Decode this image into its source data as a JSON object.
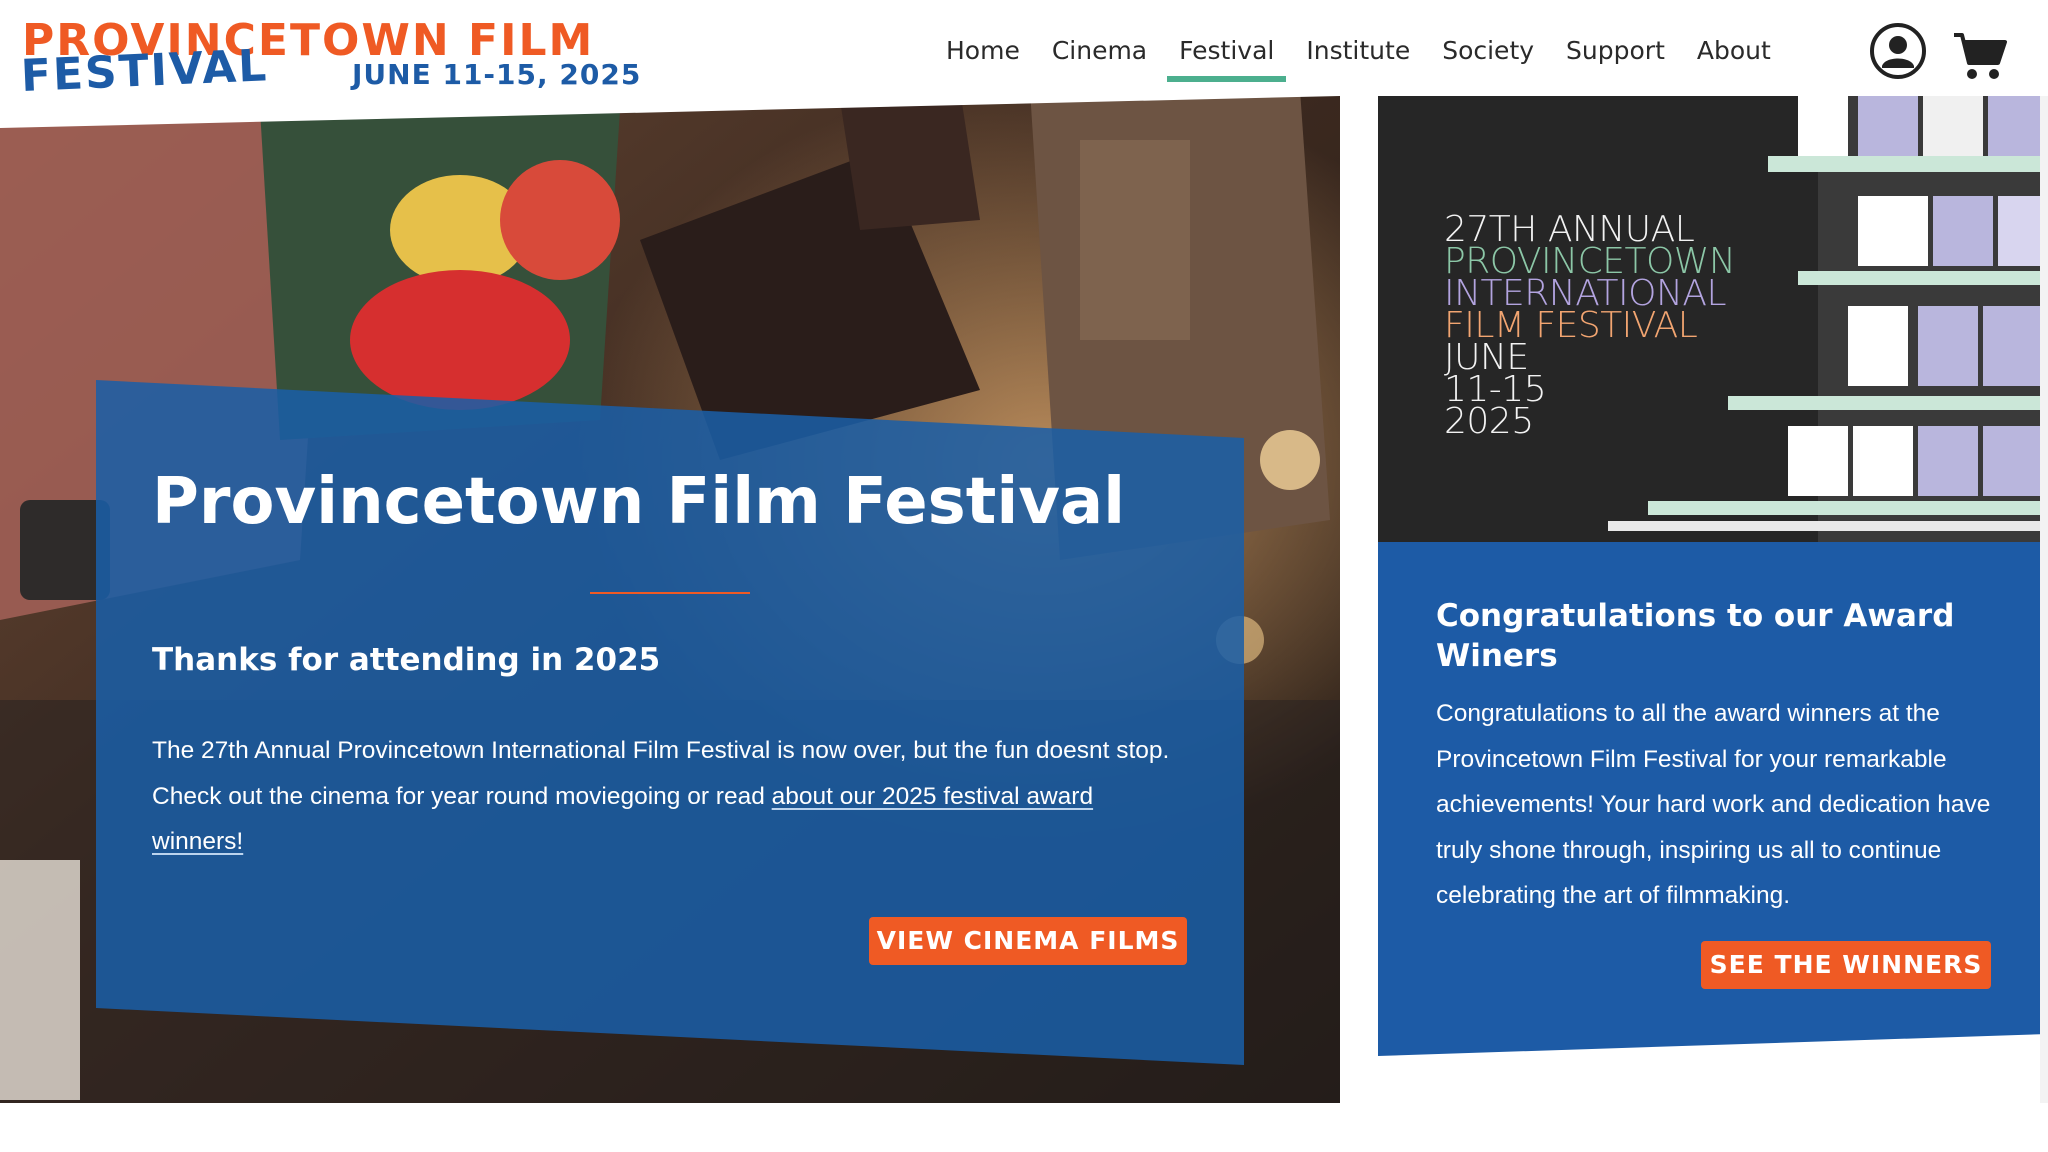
{
  "brand": {
    "line1": "PROVINCETOWN FILM",
    "line2": "FESTIVAL",
    "dates": "JUNE 11-15, 2025",
    "orange": "#ef5a24",
    "blue": "#1d5ba6"
  },
  "nav": {
    "items": [
      {
        "label": "Home"
      },
      {
        "label": "Cinema"
      },
      {
        "label": "Festival",
        "active": true
      },
      {
        "label": "Institute"
      },
      {
        "label": "Society"
      },
      {
        "label": "Support"
      },
      {
        "label": "About"
      }
    ],
    "active_underline_color": "#4caf8e",
    "account_icon": "account-icon",
    "cart_icon": "cart-icon"
  },
  "hero": {
    "title": "Provincetown Film Festival",
    "subtitle": "Thanks for attending in 2025",
    "body_text": "The 27th Annual Provincetown International Film Festival is now over, but the fun doesnt stop. Check out the cinema for year round moviegoing or read ",
    "body_link": "about our 2025 festival award winners!",
    "button_label": "VIEW CINEMA FILMS",
    "card_color": "#1a5ea8"
  },
  "poster": {
    "lines": [
      {
        "text": "27TH ANNUAL",
        "color": "#f2f2f2"
      },
      {
        "text": "PROVINCETOWN",
        "color": "#8cc7a7"
      },
      {
        "text": "INTERNATIONAL",
        "color": "#b3a4e0"
      },
      {
        "text": "FILM FESTIVAL",
        "color": "#f2a571"
      },
      {
        "text": "JUNE",
        "color": "#f2f2f2"
      },
      {
        "text": "11-15",
        "color": "#f2f2f2"
      },
      {
        "text": "2025",
        "color": "#f2f2f2"
      }
    ]
  },
  "awards": {
    "title": "Congratulations to our Award Winers",
    "body": "Congratulations to all the award winners at the Provincetown Film Festival for your remarkable achievements! Your hard work and dedication have truly shone through, inspiring us all to continue celebrating the art of filmmaking.",
    "button_label": "SEE THE WINNERS"
  }
}
